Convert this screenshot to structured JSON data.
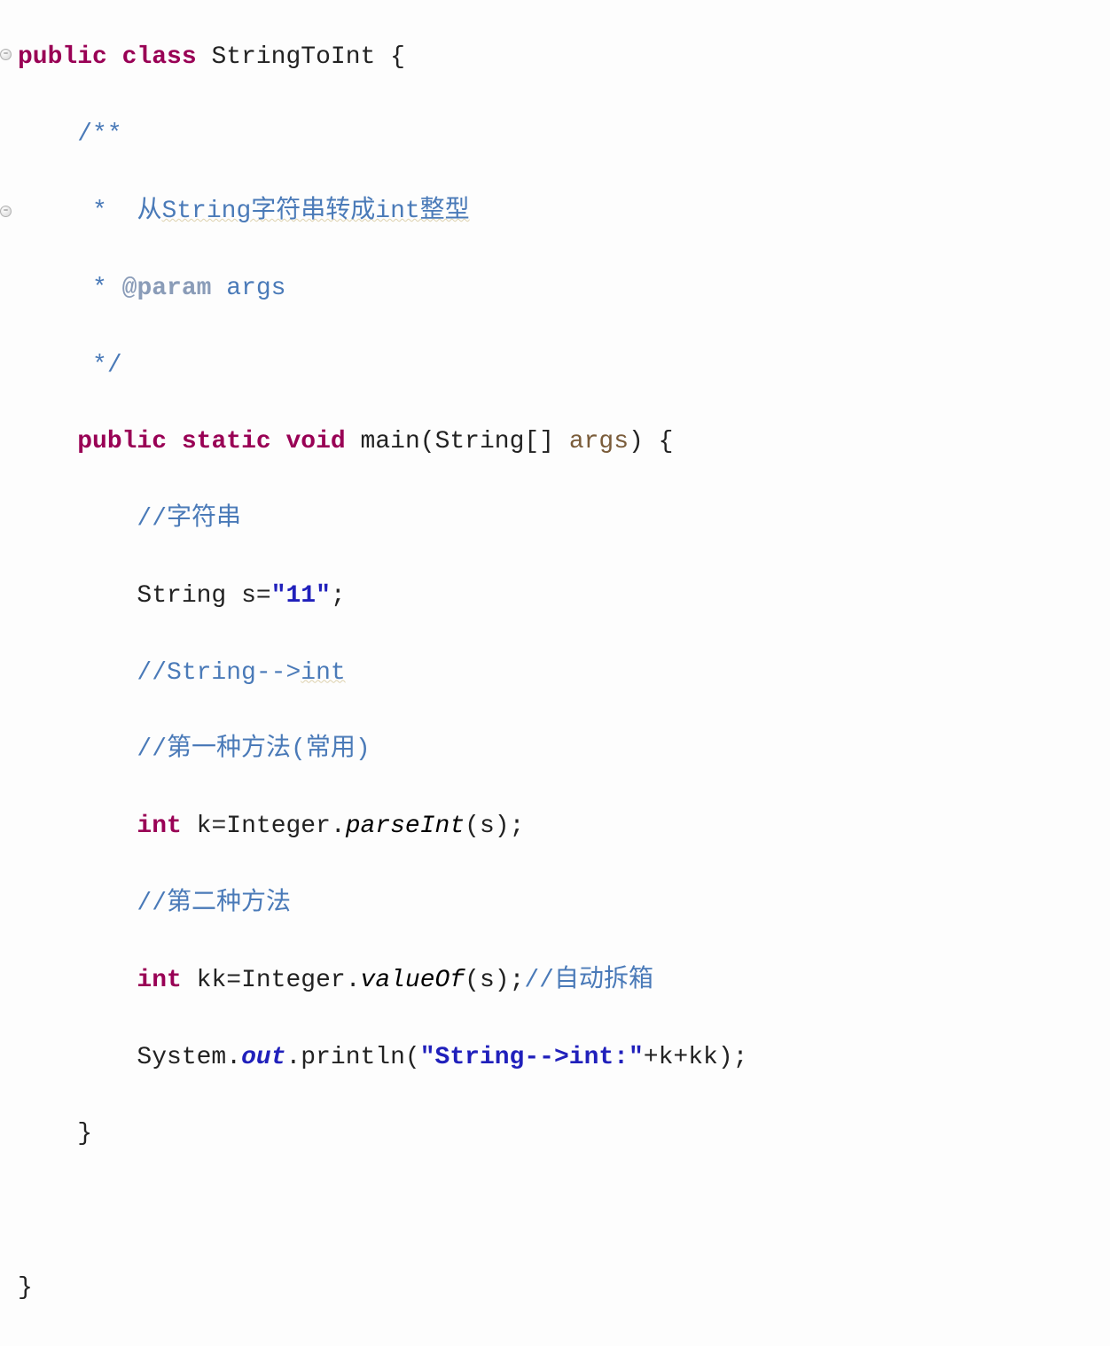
{
  "code": {
    "l1": {
      "kw_public": "public",
      "kw_class": "class",
      "class_name": "StringToInt",
      "brace": "{"
    },
    "l2": {
      "javadoc": "/**"
    },
    "l3": {
      "star": " * ",
      "text1": " 从",
      "text2": "String字符串转成int整型"
    },
    "l4": {
      "star": " * ",
      "tag": "@param",
      "args": " args"
    },
    "l5": {
      "javadoc": " */"
    },
    "l6": {
      "kw_public": "public",
      "kw_static": "static",
      "kw_void": "void",
      "method": "main",
      "open": "(",
      "type_string": "String",
      "brackets": "[]",
      "args": "args",
      "close_brace": ") {"
    },
    "l7": {
      "comment": "//字符串"
    },
    "l8": {
      "type": "String",
      "var": "s",
      "eq": "=",
      "str": "\"11\"",
      "semi": ";"
    },
    "l9": {
      "comment_prefix": "//String-->",
      "comment_int": "int"
    },
    "l10": {
      "comment": "//第一种方法(常用)"
    },
    "l11": {
      "kw_int": "int",
      "var": "k",
      "eq": "=",
      "cls": "Integer",
      "dot": ".",
      "method": "parseInt",
      "open": "(",
      "arg": "s",
      "close": ");"
    },
    "l12": {
      "comment": "//第二种方法"
    },
    "l13": {
      "kw_int": "int",
      "var": "kk",
      "eq": "=",
      "cls": "Integer",
      "dot": ".",
      "method": "valueOf",
      "open": "(",
      "arg": "s",
      "close": ");",
      "comment": "//自动拆箱"
    },
    "l14": {
      "cls": "System",
      "dot1": ".",
      "out": "out",
      "dot2": ".",
      "method": "println",
      "open": "(",
      "str": "\"String-->int:\"",
      "plus1": "+",
      "var1": "k",
      "plus2": "+",
      "var2": "kk",
      "close": ");"
    },
    "l15": {
      "brace": "}"
    },
    "l16": {
      "brace": "}"
    }
  }
}
